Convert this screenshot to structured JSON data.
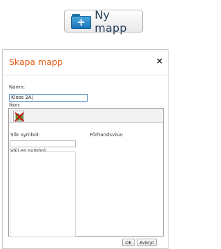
{
  "toolbar": {
    "new_folder_label": "Ny mapp"
  },
  "dialog": {
    "title": "Skapa mapp",
    "close_label": "×",
    "name_label": "Namn:",
    "name_value": "Kloss 2A|",
    "icon_label": "Ikon:",
    "search_symbol_label": "Sök symbol:",
    "preview_label": "Förhandsvisa:",
    "choose_symbol_label": "Välj en symbol:",
    "ok_label": "OK",
    "cancel_label": "Avbryt"
  },
  "colors": {
    "accent": "#e35a17",
    "folder_blue": "#1b74b6",
    "input_focus": "#6e9fcd"
  }
}
